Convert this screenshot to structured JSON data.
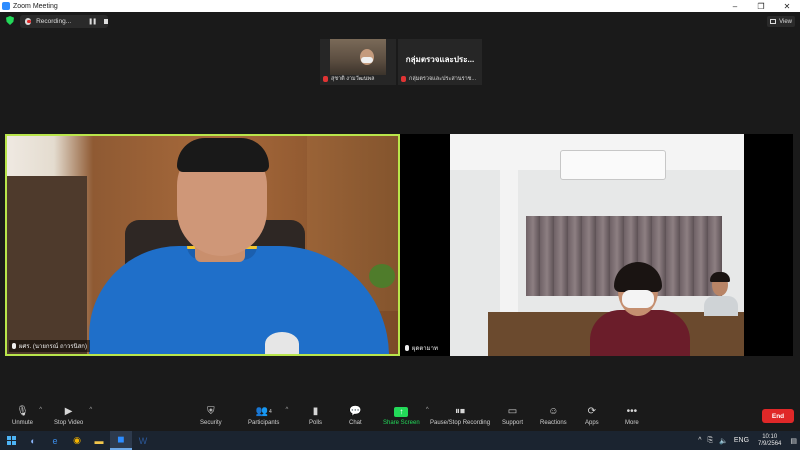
{
  "window": {
    "title": "Zoom Meeting",
    "minimize": "–",
    "maximize": "❐",
    "close": "✕"
  },
  "topbar": {
    "recording_label": "Recording...",
    "pause_icon": "❚❚",
    "view_label": "View"
  },
  "thumbnails": [
    {
      "name": "สุชาติ งามวัฒนพล"
    },
    {
      "display_name": "กลุ่มตรวจและประ...",
      "name": "กลุ่มตรวจและประสานราช..."
    }
  ],
  "tiles": {
    "left": {
      "name": "ผศร. (นายกรณ์ ถาวรนิสก)"
    },
    "right": {
      "name": "ผุดตามาท"
    }
  },
  "toolbar": {
    "unmute": "Unmute",
    "stop_video": "Stop Video",
    "security": "Security",
    "participants": "Participants",
    "participants_count": "4",
    "polls": "Polls",
    "chat": "Chat",
    "share_screen": "Share Screen",
    "pause_stop_recording": "Pause/Stop Recording",
    "support": "Support",
    "reactions": "Reactions",
    "apps": "Apps",
    "more": "More",
    "end": "End"
  },
  "taskbar": {
    "language": "ENG",
    "time": "10:10",
    "date": "7/9/2564"
  },
  "colors": {
    "active_speaker_border": "#b9e54b",
    "share_green": "#23d959",
    "end_red": "#e02828"
  }
}
